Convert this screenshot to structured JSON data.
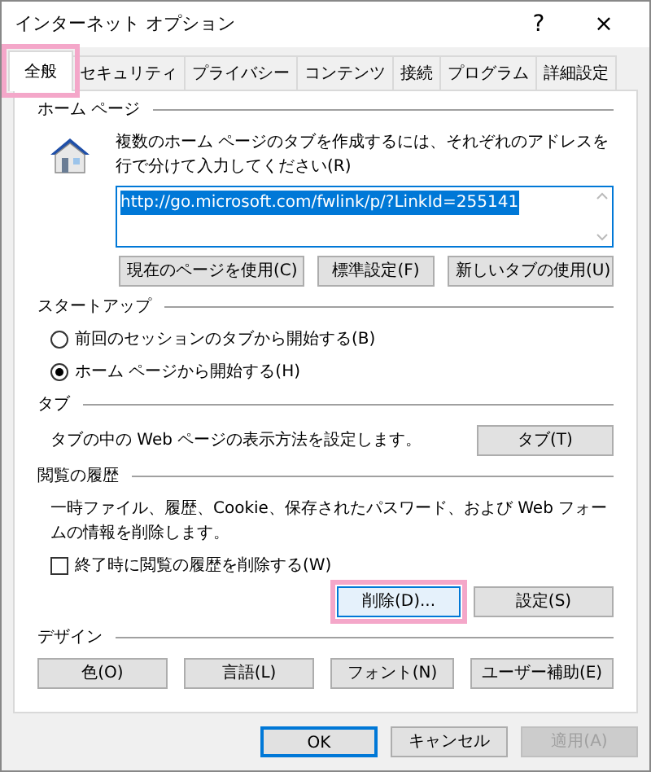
{
  "window": {
    "title": "インターネット オプション",
    "help": "?",
    "close": "×"
  },
  "tabs": [
    {
      "label": "全般",
      "selected": true,
      "highlighted": true
    },
    {
      "label": "セキュリティ",
      "selected": false,
      "highlighted": false
    },
    {
      "label": "プライバシー",
      "selected": false,
      "highlighted": false
    },
    {
      "label": "コンテンツ",
      "selected": false,
      "highlighted": false
    },
    {
      "label": "接続",
      "selected": false,
      "highlighted": false
    },
    {
      "label": "プログラム",
      "selected": false,
      "highlighted": false
    },
    {
      "label": "詳細設定",
      "selected": false,
      "highlighted": false
    }
  ],
  "sections": [
    {
      "kind": "homepage",
      "title": "ホーム ページ",
      "description": "複数のホーム ページのタブを作成するには、それぞれのアドレスを行で分けて入力してください(R)",
      "value": "http://go.microsoft.com/fwlink/p/?LinkId=255141",
      "buttons": [
        {
          "label": "現在のページを使用(C)",
          "highlighted": false
        },
        {
          "label": "標準設定(F)",
          "highlighted": false
        },
        {
          "label": "新しいタブの使用(U)",
          "highlighted": false
        }
      ]
    },
    {
      "kind": "startup",
      "title": "スタートアップ",
      "options": [
        {
          "label": "前回のセッションのタブから開始する(B)",
          "selected": false
        },
        {
          "label": "ホーム ページから開始する(H)",
          "selected": true
        }
      ]
    },
    {
      "kind": "tabs",
      "title": "タブ",
      "description": "タブの中の Web ページの表示方法を設定します。",
      "buttons": [
        {
          "label": "タブ(T)",
          "highlighted": false
        }
      ]
    },
    {
      "kind": "history",
      "title": "閲覧の履歴",
      "description": "一時ファイル、履歴、Cookie、保存されたパスワード、および Web フォームの情報を削除します。",
      "checkbox": {
        "label": "終了時に閲覧の履歴を削除する(W)",
        "checked": false
      },
      "buttons": [
        {
          "label": "削除(D)...",
          "highlighted": true
        },
        {
          "label": "設定(S)",
          "highlighted": false
        }
      ]
    },
    {
      "kind": "design",
      "title": "デザイン",
      "buttons": [
        {
          "label": "色(O)",
          "highlighted": false
        },
        {
          "label": "言語(L)",
          "highlighted": false
        },
        {
          "label": "フォント(N)",
          "highlighted": false
        },
        {
          "label": "ユーザー補助(E)",
          "highlighted": false
        }
      ]
    }
  ],
  "footer": [
    {
      "label": "OK",
      "default": true,
      "disabled": false
    },
    {
      "label": "キャンセル",
      "default": false,
      "disabled": false
    },
    {
      "label": "適用(A)",
      "default": false,
      "disabled": true
    }
  ]
}
